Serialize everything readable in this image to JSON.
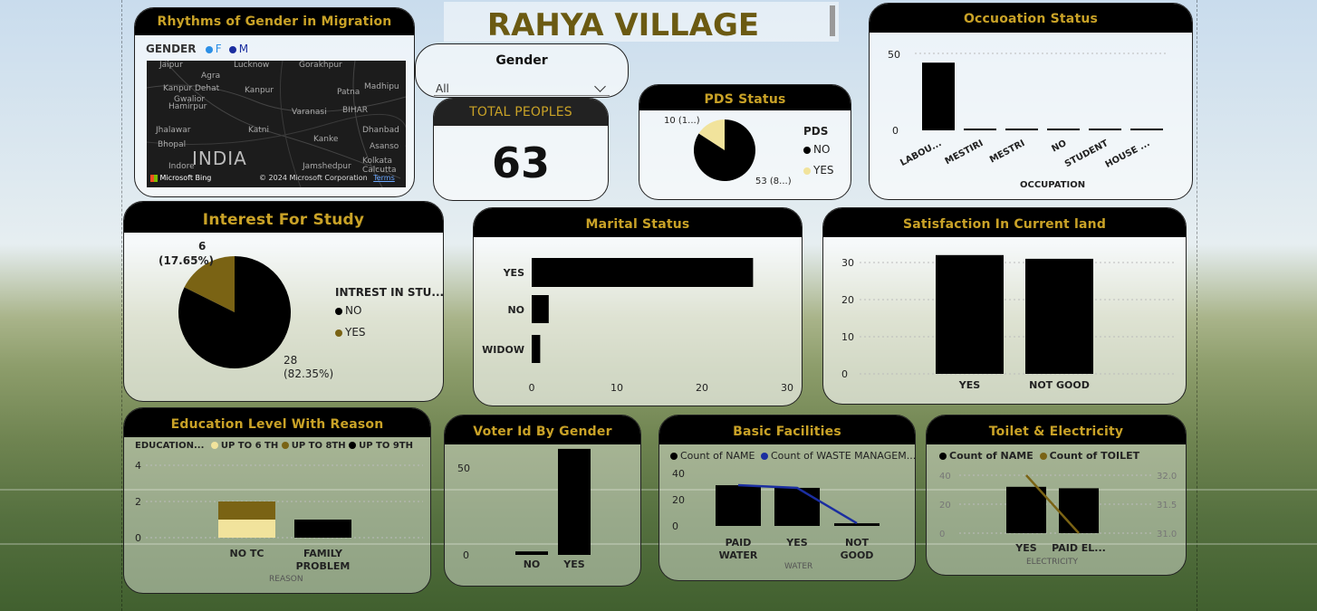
{
  "title": "RAHYA VILLAGE",
  "map_card": {
    "title": "Rhythms of Gender in Migration",
    "legend_title": "GENDER",
    "legend": [
      {
        "label": "F",
        "color": "#2b8fe6"
      },
      {
        "label": "M",
        "color": "#1b2ea0"
      }
    ],
    "places": [
      "Jaipur",
      "Lucknow",
      "Gorakhpur",
      "Agra",
      "Kanpur Dehat",
      "Kanpur",
      "Patna",
      "Madhipu",
      "Gwalior",
      "Hamirpur",
      "Varanasi",
      "BIHAR",
      "Jhalawar",
      "Katni",
      "Dhanbad",
      "Bhopal",
      "Kanke",
      "Asanso",
      "INDIA",
      "Kolkata",
      "Indore",
      "Jamshedpur",
      "Calcutta"
    ],
    "attribution": "© 2024 Microsoft Corporation",
    "terms": "Terms",
    "bing": "Microsoft Bing"
  },
  "gender_filter": {
    "label": "Gender",
    "value": "All"
  },
  "total_card": {
    "title": "TOTAL PEOPLES",
    "value": "63"
  },
  "pds_card": {
    "title": "PDS Status",
    "legend_title": "PDS",
    "legend": [
      {
        "label": "NO",
        "color": "#000000"
      },
      {
        "label": "YES",
        "color": "#f1e39c"
      }
    ],
    "label_small": "10 (1...)",
    "label_large": "53 (8...)"
  },
  "occupation_card": {
    "title": "Occuoation Status",
    "xlabel": "OCCUPATION",
    "yticks": [
      "50",
      "0"
    ]
  },
  "interest_card": {
    "title": "Interest For Study",
    "legend_title": "INTREST IN STU...",
    "legend": [
      {
        "label": "NO",
        "color": "#000000"
      },
      {
        "label": "YES",
        "color": "#7a6314"
      }
    ],
    "yes_value": "6",
    "yes_pct": "(17.65%)",
    "no_value": "28",
    "no_pct": "(82.35%)"
  },
  "marital_card": {
    "title": "Marital Status",
    "xticks": [
      "0",
      "10",
      "20",
      "30"
    ]
  },
  "satisfaction_card": {
    "title": "Satisfaction In Current land",
    "yticks": [
      "30",
      "20",
      "10",
      "0"
    ]
  },
  "education_card": {
    "title": "Education Level With Reason",
    "legend_title": "EDUCATION...",
    "legend": [
      {
        "label": "UP TO 6 TH",
        "color": "#f1e39c"
      },
      {
        "label": "UP TO 8TH",
        "color": "#7a6314"
      },
      {
        "label": "UP TO 9TH",
        "color": "#000000"
      }
    ],
    "yticks": [
      "4",
      "2",
      "0"
    ],
    "xlabel": "REASON",
    "categories": [
      "NO TC",
      "FAMILY PROBLEM"
    ]
  },
  "voter_card": {
    "title": "Voter Id By Gender",
    "yticks": [
      "50",
      "0"
    ],
    "categories": [
      "NO",
      "YES"
    ]
  },
  "facilities_card": {
    "title": "Basic Facilities",
    "legend": [
      {
        "label": "Count of NAME",
        "color": "#000000"
      },
      {
        "label": "Count of WASTE MANAGEM...",
        "color": "#1b2ea0"
      }
    ],
    "yticks": [
      "40",
      "20",
      "0"
    ],
    "xlabel": "WATER",
    "categories": [
      "PAID WATER",
      "YES",
      "NOT GOOD"
    ]
  },
  "toilet_card": {
    "title": "Toilet & Electricity",
    "legend": [
      {
        "label": "Count of NAME",
        "color": "#000000"
      },
      {
        "label": "Count of TOILET",
        "color": "#7a6314"
      }
    ],
    "yticks_left": [
      "40",
      "20",
      "0"
    ],
    "yticks_right": [
      "32.0",
      "31.5",
      "31.0"
    ],
    "xlabel": "ELECTRICITY",
    "categories": [
      "YES",
      "PAID EL..."
    ]
  },
  "chart_data": [
    {
      "type": "bar",
      "title": "Occuoation Status",
      "xlabel": "OCCUPATION",
      "categories": [
        "LABOU...",
        "MESTIRI",
        "MESTRI",
        "NO",
        "STUDENT",
        "HOUSE ..."
      ],
      "values": [
        44,
        1,
        1,
        1,
        1,
        0
      ],
      "ylim": [
        0,
        50
      ]
    },
    {
      "type": "pie",
      "title": "PDS Status",
      "categories": [
        "NO",
        "YES"
      ],
      "values": [
        53,
        10
      ]
    },
    {
      "type": "pie",
      "title": "Interest For Study",
      "categories": [
        "NO",
        "YES"
      ],
      "values": [
        28,
        6
      ]
    },
    {
      "type": "bar",
      "title": "Marital Status",
      "orientation": "horizontal",
      "categories": [
        "YES",
        "NO",
        "WIDOW"
      ],
      "values": [
        26,
        2,
        1
      ],
      "xlim": [
        0,
        30
      ]
    },
    {
      "type": "bar",
      "title": "Satisfaction In Current land",
      "categories": [
        "YES",
        "NOT GOOD"
      ],
      "values": [
        32,
        31
      ],
      "ylim": [
        0,
        33
      ]
    },
    {
      "type": "bar",
      "title": "Education Level With Reason",
      "stacked": true,
      "xlabel": "REASON",
      "categories": [
        "NO TC",
        "FAMILY PROBLEM"
      ],
      "series": [
        {
          "name": "UP TO 6 TH",
          "values": [
            1,
            0
          ]
        },
        {
          "name": "UP TO 8TH",
          "values": [
            1,
            0
          ]
        },
        {
          "name": "UP TO 9TH",
          "values": [
            0,
            1
          ]
        }
      ],
      "ylim": [
        0,
        4
      ]
    },
    {
      "type": "bar",
      "title": "Voter Id By Gender",
      "categories": [
        "NO",
        "YES"
      ],
      "values": [
        2,
        61
      ],
      "ylim": [
        0,
        60
      ]
    },
    {
      "type": "bar",
      "title": "Basic Facilities",
      "xlabel": "WATER",
      "categories": [
        "PAID WATER",
        "YES",
        "NOT GOOD"
      ],
      "series": [
        {
          "name": "Count of NAME",
          "type": "bar",
          "values": [
            31,
            29,
            2
          ]
        },
        {
          "name": "Count of WASTE MANAGEM...",
          "type": "line",
          "values": [
            31,
            29,
            2
          ]
        }
      ],
      "ylim": [
        0,
        45
      ]
    },
    {
      "type": "bar",
      "title": "Toilet & Electricity",
      "xlabel": "ELECTRICITY",
      "categories": [
        "YES",
        "PAID EL..."
      ],
      "series": [
        {
          "name": "Count of NAME",
          "type": "bar",
          "values": [
            32,
            31
          ]
        },
        {
          "name": "Count of TOILET",
          "type": "line",
          "values": [
            32,
            31
          ]
        }
      ],
      "ylim": [
        0,
        40
      ],
      "y2lim": [
        31,
        32
      ]
    }
  ]
}
